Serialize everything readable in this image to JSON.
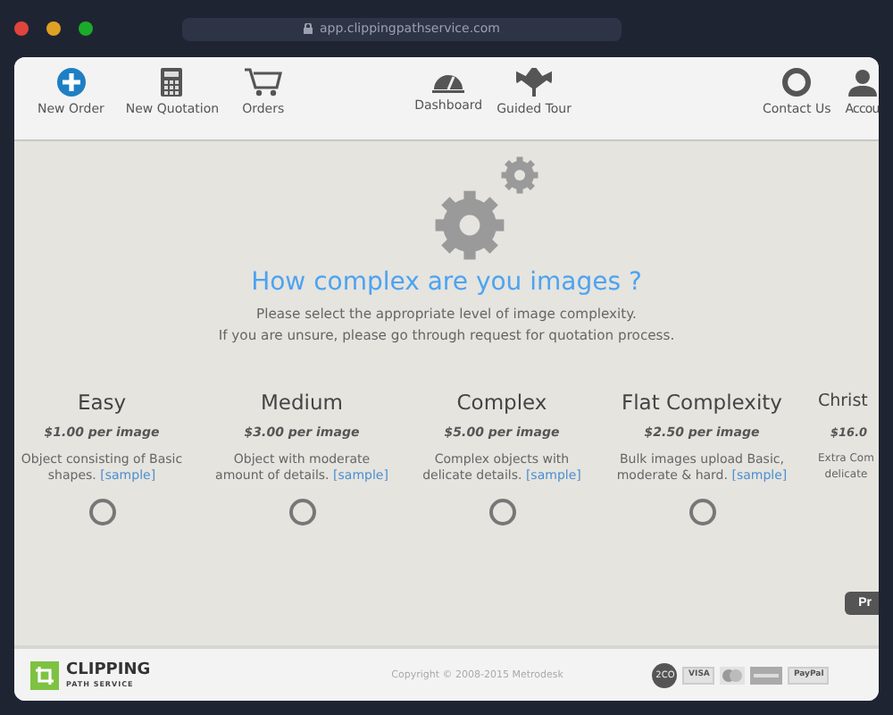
{
  "browser": {
    "url": "app.clippingpathservice.com"
  },
  "nav": {
    "items": [
      {
        "label": "New Order"
      },
      {
        "label": "New Quotation"
      },
      {
        "label": "Orders"
      },
      {
        "label": "Dashboard"
      },
      {
        "label": "Guided Tour"
      },
      {
        "label": "Contact Us"
      },
      {
        "label": "Accou"
      }
    ]
  },
  "heading": "How complex are you images ?",
  "intro": [
    "Please select the appropriate level of image complexity.",
    "If you are unsure, please go through request for quotation process."
  ],
  "options": [
    {
      "title": "Easy",
      "price": "$1.00 per image",
      "lines": [
        "Object consisting of Basic",
        "shapes."
      ],
      "link": "[sample]",
      "selected": false
    },
    {
      "title": "Medium",
      "price": "$3.00 per image",
      "lines": [
        "Object with moderate",
        "amount of details."
      ],
      "link": "[sample]",
      "selected": false
    },
    {
      "title": "Complex",
      "price": "$5.00 per image",
      "lines": [
        "Complex objects with",
        "delicate details."
      ],
      "link": "[sample]",
      "selected": false
    },
    {
      "title": "Flat Complexity",
      "price": "$2.50 per image",
      "lines": [
        "Bulk images upload Basic,",
        "moderate & hard."
      ],
      "link": "[sample]",
      "selected": false
    },
    {
      "title": "Christ",
      "price": "$16.0",
      "lines": [
        "Extra Com",
        "delicate"
      ]
    }
  ],
  "next_button": "Pr",
  "footer": {
    "logo_top": "CLIPPING",
    "logo_bottom": "PATH SERVICE",
    "copyright": "Copyright © 2008-2015 Metrodesk",
    "payments": [
      "2CO",
      "VISA",
      "PayPal"
    ]
  }
}
